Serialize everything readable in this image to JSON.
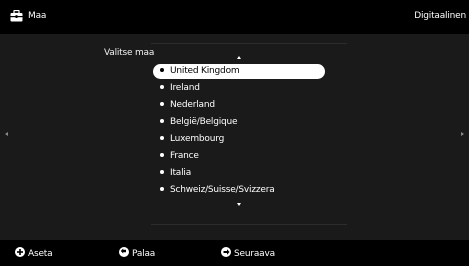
{
  "header": {
    "title": "Maa",
    "source": "Digitaalinen",
    "icon": "toolbox-icon"
  },
  "content": {
    "field_label": "Valitse maa",
    "countries": [
      {
        "label": "United Kingdom",
        "selected": true
      },
      {
        "label": "Ireland",
        "selected": false
      },
      {
        "label": "Nederland",
        "selected": false
      },
      {
        "label": "België/Belgique",
        "selected": false
      },
      {
        "label": "Luxembourg",
        "selected": false
      },
      {
        "label": "France",
        "selected": false
      },
      {
        "label": "Italia",
        "selected": false
      },
      {
        "label": "Schweiz/Suisse/Svizzera",
        "selected": false
      }
    ]
  },
  "footer": {
    "set_label": "Aseta",
    "back_label": "Palaa",
    "next_label": "Seuraava"
  },
  "colors": {
    "background": "#1a1a1a",
    "bars": "#000000",
    "selected_bg": "#ffffff",
    "text": "#ffffff"
  }
}
